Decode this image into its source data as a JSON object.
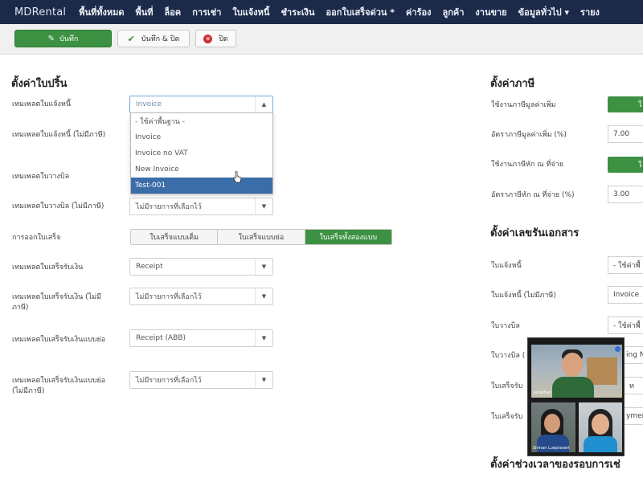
{
  "navbar": {
    "brand": "MDRental",
    "items": [
      "พื้นที่ทั้งหมด",
      "พื้นที่",
      "ล็อค",
      "การเช่า",
      "ใบแจ้งหนี้",
      "ชำระเงิน",
      "ออกใบเสร็จด่วน *",
      "ค่าร้อง",
      "ลูกค้า",
      "งานขาย",
      "ข้อมูลทั่วไป ▾",
      "รายง"
    ]
  },
  "toolbar": {
    "save_label": "บันทึก",
    "save_close_label": "บันทึก & ปิด",
    "close_label": "ปิด"
  },
  "left": {
    "heading": "ตั้งค่าใบปริ้น",
    "rows": [
      {
        "label": "เทมเพลตใบแจ้งหนี้",
        "value": "Invoice"
      },
      {
        "label": "เทมเพลตใบแจ้งหนี้ (ไม่มีภาษี)",
        "value": ""
      },
      {
        "label": "เทมเพลตใบวางบิล",
        "value": ""
      },
      {
        "label": "เทมเพลตใบวางบิล (ไม่มีภาษี)",
        "value": "ไม่มีรายการที่เลือกไว้"
      },
      {
        "label": "การออกใบเสร็จ",
        "value": ""
      },
      {
        "label": "เทมเพลตใบเสร็จรับเงิน",
        "value": "Receipt"
      },
      {
        "label": "เทมเพลตใบเสร็จรับเงิน (ไม่มีภาษี)",
        "value": "ไม่มีรายการที่เลือกไว้"
      },
      {
        "label": "เทมเพลตใบเสร็จรับเงินแบบย่อ",
        "value": "Receipt (ABB)"
      },
      {
        "label": "เทมเพลตใบเสร็จรับเงินแบบย่อ (ไม่มีภาษี)",
        "value": "ไม่มีรายการที่เลือกไว้"
      }
    ],
    "dropdown_options": [
      "- ใช้ค่าพื้นฐาน -",
      "Invoice",
      "Invoice no VAT",
      "New Invoice",
      "Test-001"
    ],
    "receipt_modes": [
      "ใบเสร็จแบบเต็ม",
      "ใบเสร็จแบบย่อ",
      "ใบเสร็จทั้งสองแบบ"
    ]
  },
  "right": {
    "tax_heading": "ตั้งค่าภาษี",
    "tax_rows": [
      {
        "label": "ใช้งานภาษีมูลค่าเพิ่ม",
        "value": "ใ"
      },
      {
        "label": "อัตราภาษีมูลค่าเพิ่ม (%)",
        "value": "7.00"
      },
      {
        "label": "ใช้งานภาษีหัก ณ ที่จ่าย",
        "value": "ใ"
      },
      {
        "label": "อัตราภาษีหัก ณ ที่จ่าย (%)",
        "value": "3.00"
      }
    ],
    "doc_heading": "ตั้งค่าเลขรันเอกสาร",
    "doc_rows": [
      {
        "label": "ใบแจ้งหนี้",
        "value": "- ใช้ค่าพื้"
      },
      {
        "label": "ใบแจ้งหนี้ (ไม่มีภาษี)",
        "value": "Invoice"
      },
      {
        "label": "ใบวางบิล",
        "value": "- ใช้ค่าพื้"
      },
      {
        "label": "ใบวางบิล (",
        "value": "ing N"
      },
      {
        "label": "ใบเสร็จรับ",
        "value": "ท"
      },
      {
        "label": "ใบเสร็จรับ",
        "value": "ymen"
      }
    ],
    "period_heading": "ตั้งค่าช่วงเวลาของรอบการเช่"
  },
  "video": {
    "caption1": "Jonathan",
    "caption2": "Sirinan Lueprasert"
  }
}
